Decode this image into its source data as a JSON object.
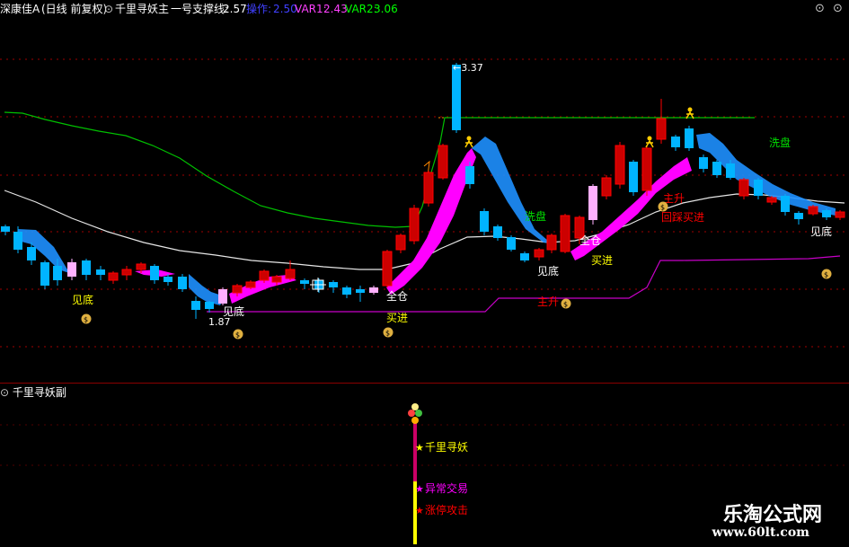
{
  "header": {
    "stock": "深康佳A",
    "period": "(日线 前复权)",
    "indicator": "千里寻妖主",
    "support_label": "一号支撑线:",
    "support_value": "2.57",
    "op_label": "操作:",
    "op_value": "2.50",
    "var1_label": "VAR1:",
    "var1_value": "2.43",
    "var2_label": "VAR2:",
    "var2_value": "3.06"
  },
  "sub_header": {
    "indicator": "千里寻妖副"
  },
  "annotations": {
    "high": "3.37",
    "low": "1.87",
    "jiandi": "见底",
    "quancang": "全仓",
    "mairu": "买进",
    "xipan": "洗盘",
    "zhusheng": "主升",
    "huicai": "回踩买进"
  },
  "sub_labels": {
    "a": "千里寻妖",
    "b": "异常交易",
    "c": "涨停攻击"
  },
  "watermark": {
    "name": "乐淘公式网",
    "url": "www.60lt.com"
  },
  "colors": {
    "bg": "#000000",
    "up": "#ff0000",
    "down": "#00b4ff",
    "band": "#ff00ff",
    "band_down": "#1e90ff",
    "green_line": "#00c000",
    "white_line": "#e6e6e6",
    "purple_line": "#c800c8",
    "grid": "#a00000",
    "yellow": "#ffff00"
  }
}
